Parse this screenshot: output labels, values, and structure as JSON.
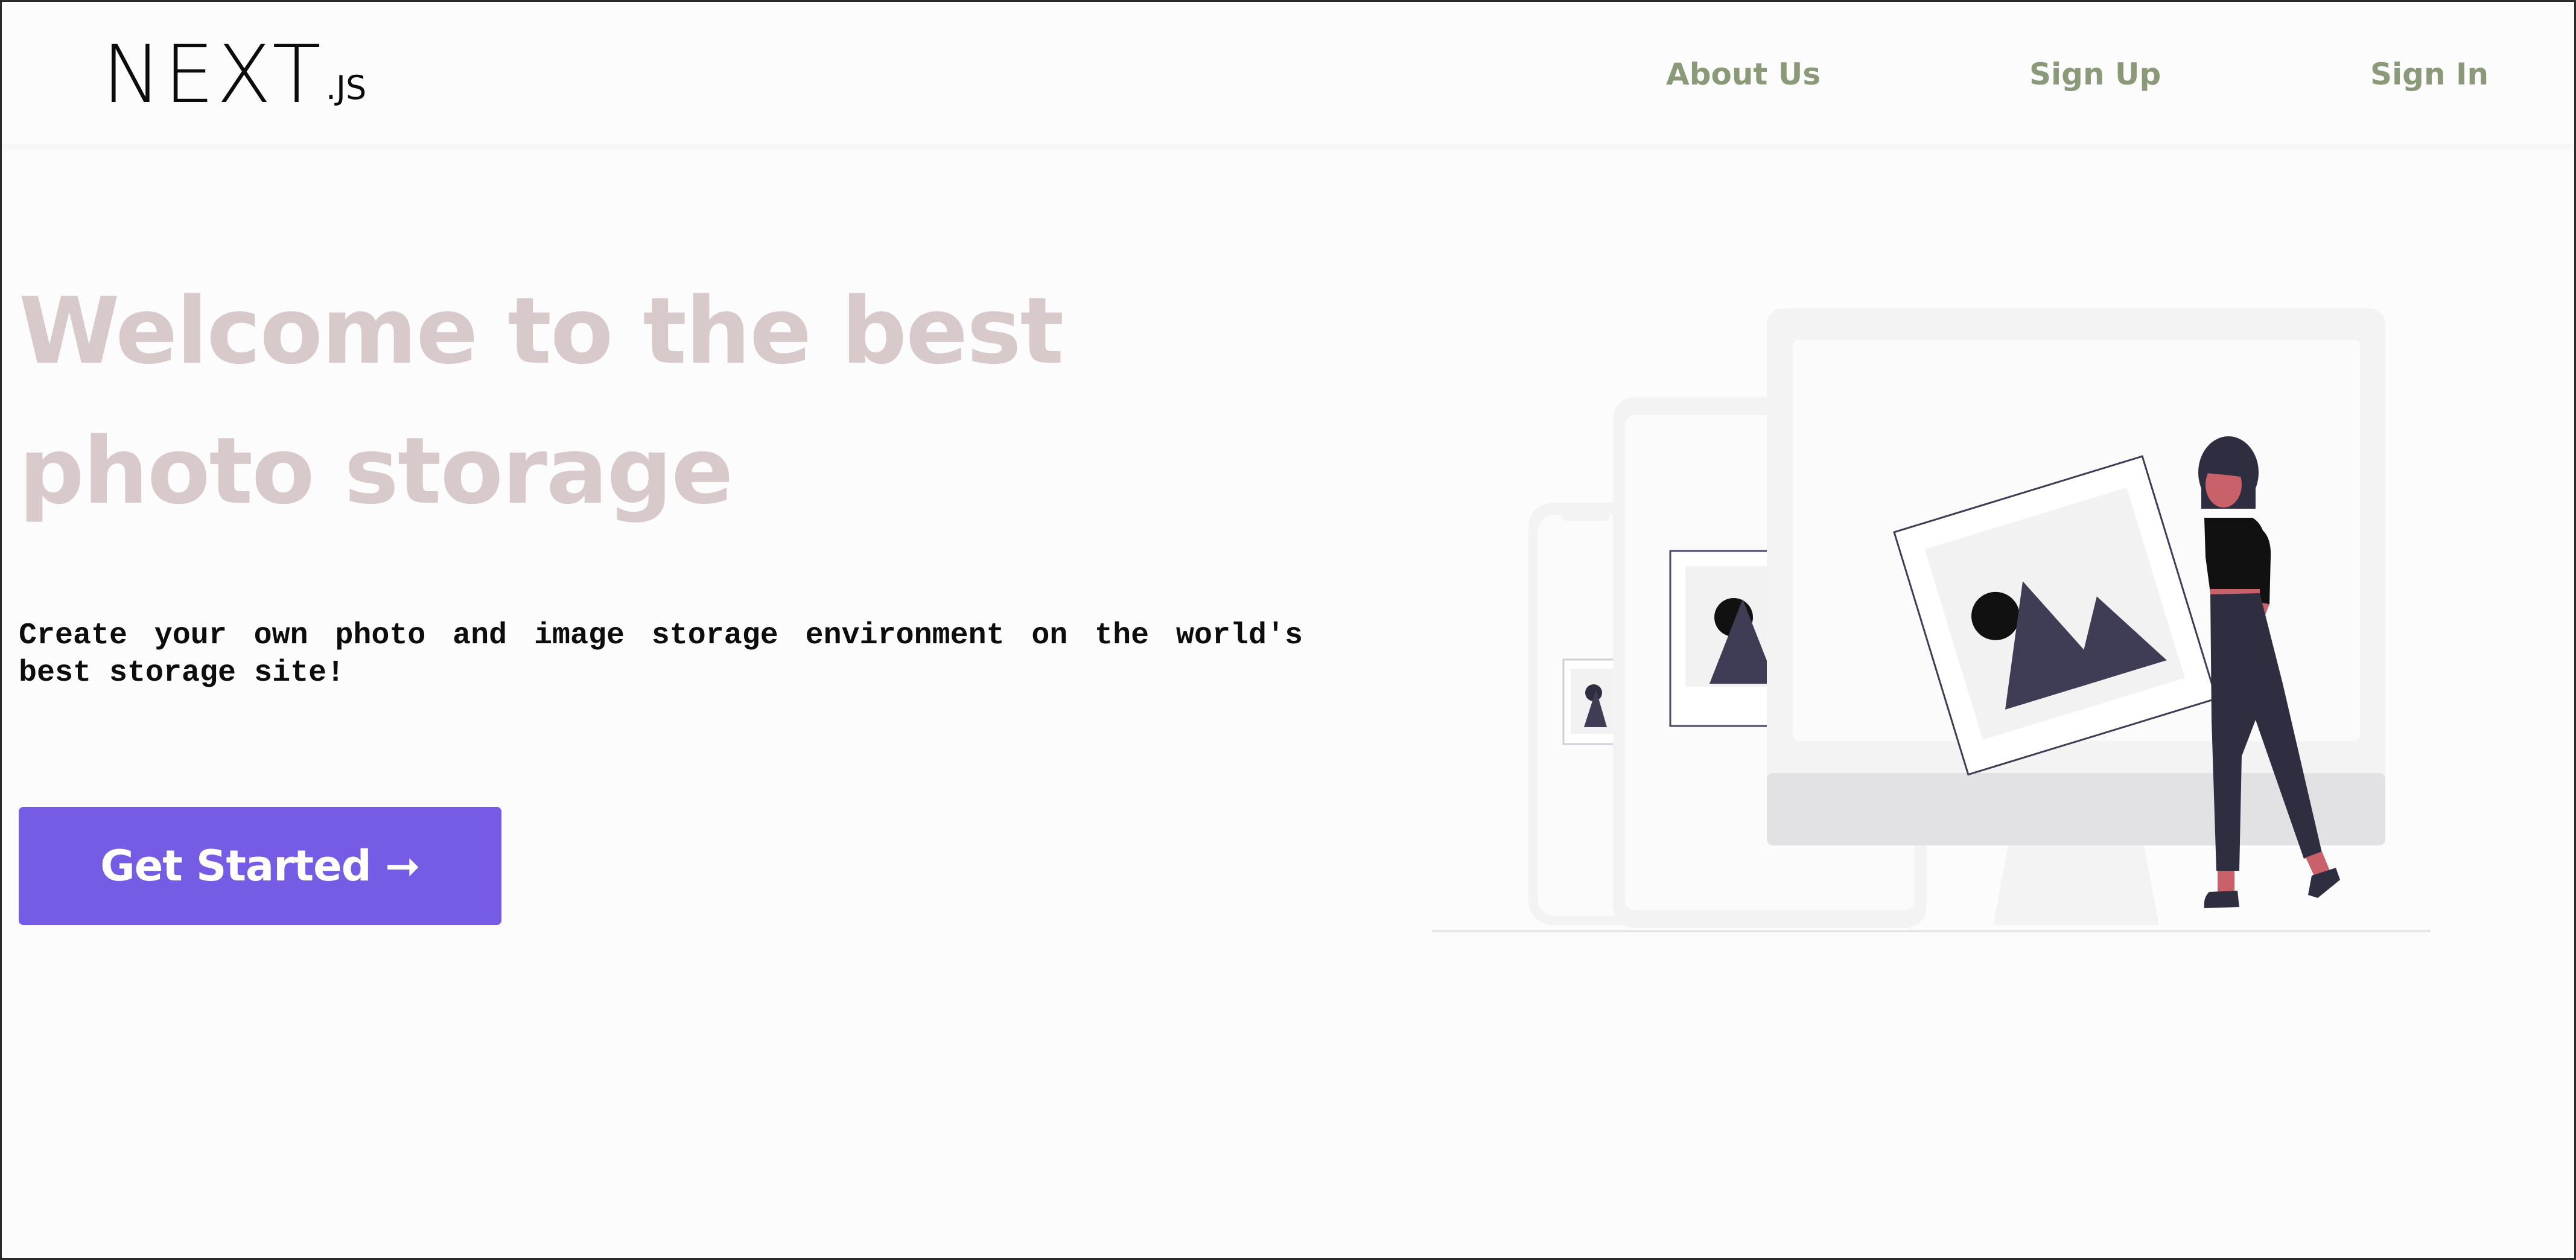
{
  "header": {
    "logo": {
      "main": "NEXT",
      "sub": ".JS"
    },
    "nav": {
      "about": "About Us",
      "signup": "Sign Up",
      "signin": "Sign In"
    }
  },
  "hero": {
    "title": "Welcome to the best photo storage",
    "description": "Create your own photo and image storage environment on the world's best storage site!",
    "cta_label": "Get Started ➞"
  },
  "illustration": {
    "icon": "photo-storage-illustration"
  },
  "colors": {
    "nav_link": "#8a9a78",
    "title": "#d8caca",
    "cta_background": "#765ce4",
    "cta_text": "#ffffff",
    "illustration_accent": "#3f3d56",
    "illustration_skin": "#c9616b"
  }
}
